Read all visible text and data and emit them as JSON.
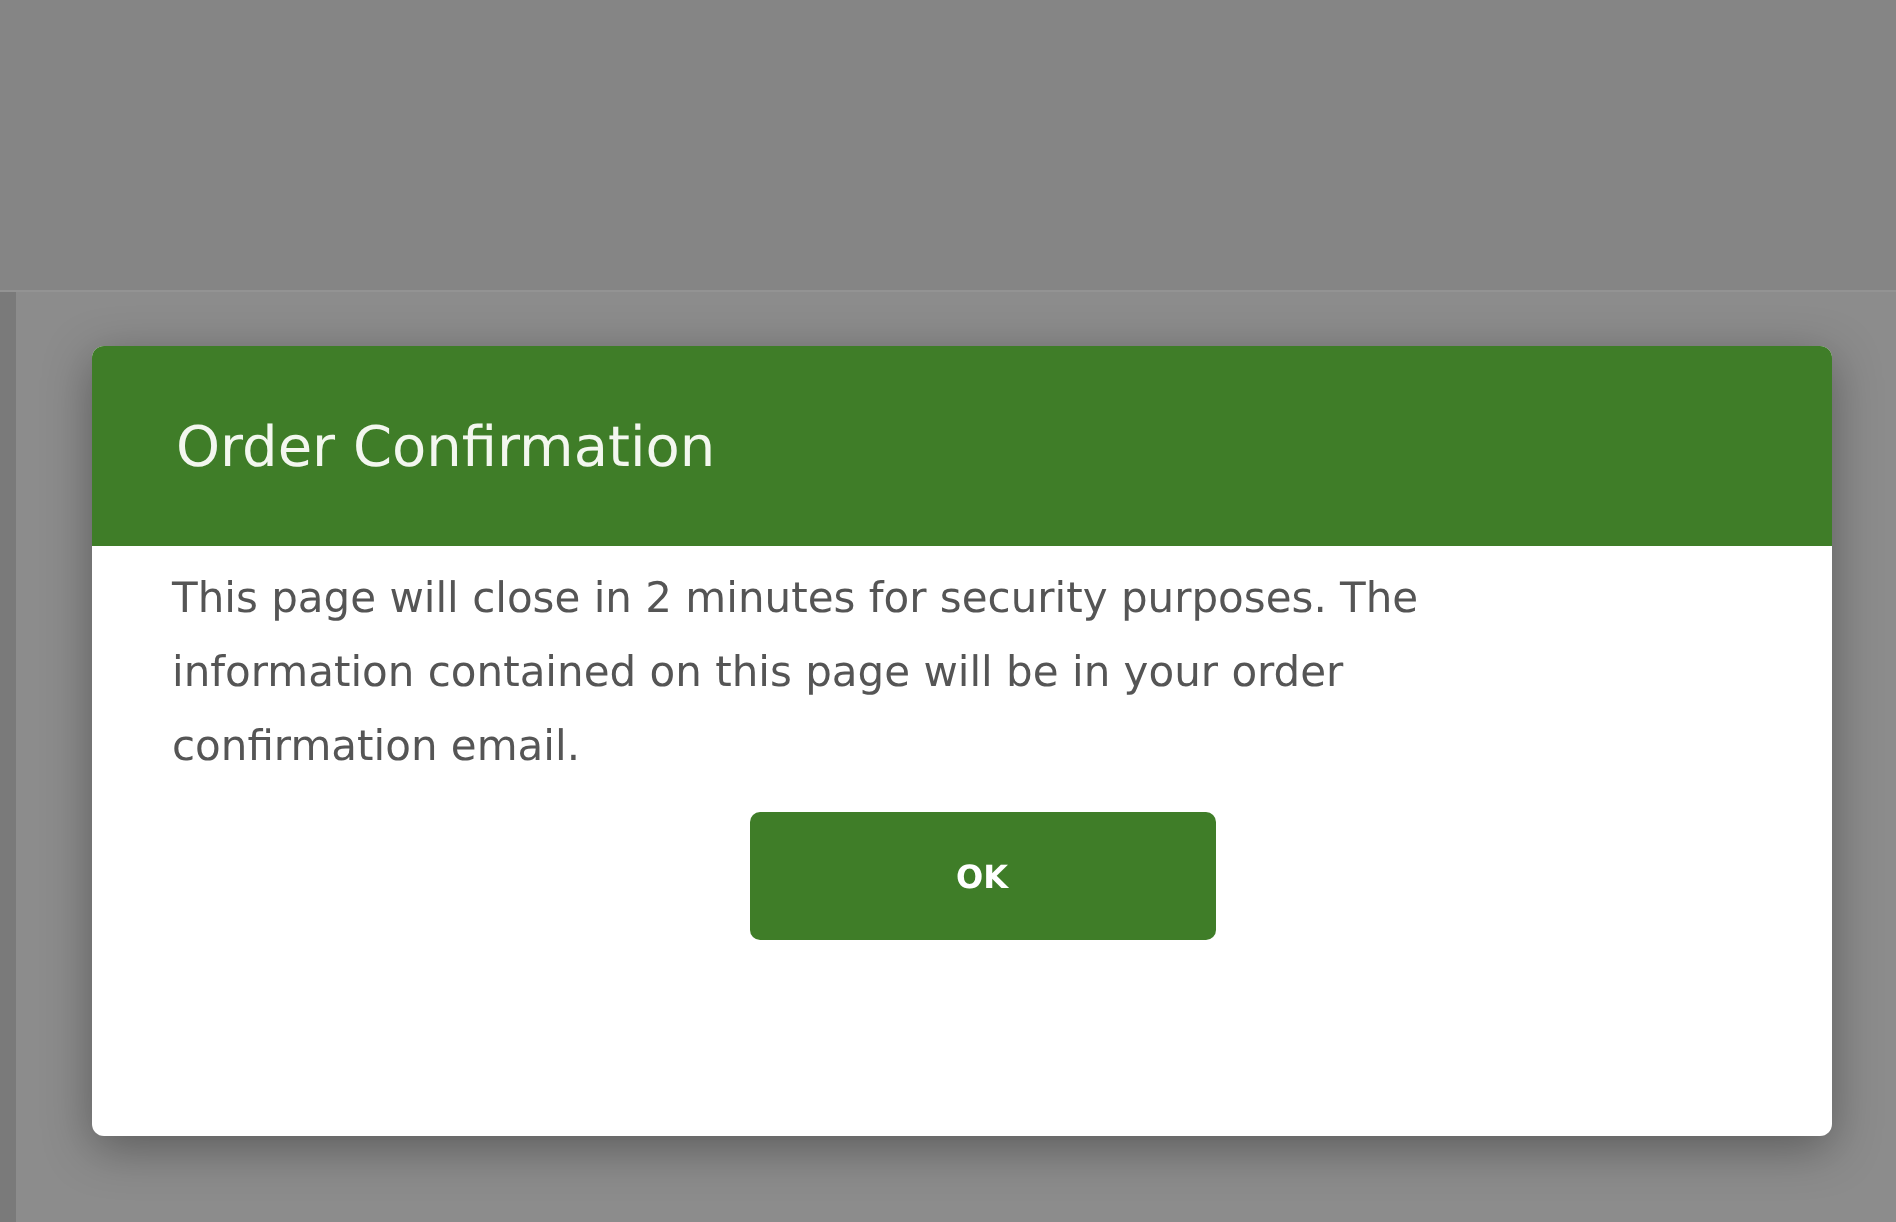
{
  "dialog": {
    "title": "Order Confirmation",
    "message": "This page will close in 2 minutes for security purposes. The information contained on this page will be in your order confirmation email.",
    "buttons": [
      "OK"
    ]
  }
}
